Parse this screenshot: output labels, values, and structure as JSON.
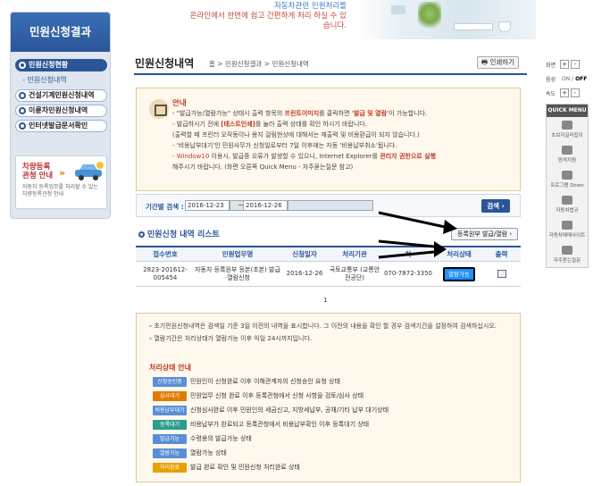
{
  "banner": {
    "line1": "자동차관련 민원처리를",
    "line2": "온라인에서 한번에 쉽고 간편하게 처리 하실 수 있습니다."
  },
  "sidebar": {
    "title": "민원신청결과",
    "items": [
      {
        "label": "민원신청현황",
        "active": true
      },
      {
        "label": "건설기계민원신청내역",
        "active": false
      },
      {
        "label": "이륜차민원신청내역",
        "active": false
      },
      {
        "label": "인터넷발급문서확인",
        "active": false
      }
    ],
    "sub_item": "민원신청내역",
    "car": {
      "title_line1": "차량등록",
      "title_line2": "관청 안내",
      "desc": "자동차 등록업무를 처리할 수 있는 차량등록관청 안내"
    }
  },
  "header": {
    "title": "민원신청내역",
    "breadcrumb": [
      "홈",
      "민원신청결과",
      "민원신청내역"
    ],
    "print_label": "인쇄하기"
  },
  "notice": {
    "title": "안내",
    "lines": [
      {
        "parts": [
          "- \"발급가능/열람가능\" 상태시 출력 항목의 ",
          "프린트이미지",
          "를 클릭하면 ",
          "'발급 및 열람'",
          "이 가능합니다."
        ]
      },
      {
        "parts": [
          "- 발급하시기 전에 ",
          "[테스트인쇄]",
          "를 눌러 출력 상태를 확인 하시기 바랍니다."
        ]
      },
      {
        "parts": [
          "  (출력할 때 프린터 오작동이나 용지 걸림현상에 대해서는 재출력 및 비용환급이 되지 않습니다.)"
        ]
      },
      {
        "parts": [
          "- '비용납부대기'인 민원사무가 신청일로부터 7일 이후에는 자동 '비용납부취소'됩니다."
        ]
      },
      {
        "parts": [
          "- ",
          "Window10",
          " 이용시, 발급중 오류가 발생할 수 있으니, Internet Explorer를 ",
          "관리자 권한으로 실행"
        ]
      },
      {
        "parts": [
          "  해주시기 바랍니다. (화면 오른쪽 Quick Menu - 자주묻는질문 참고)"
        ]
      }
    ]
  },
  "search": {
    "label": "기간별 검색 :",
    "from": "2016-12-23",
    "to": "2016-12-26",
    "button": "검색"
  },
  "list": {
    "title": "민원신청 내역 리스트",
    "reg_button": "등록원부 발급/열람",
    "columns": [
      "접수번호",
      "민원업무명",
      "신청일자",
      "처리기관",
      "처",
      "처리상태",
      "출력"
    ],
    "rows": [
      {
        "receipt_no": "2823-201612-005454",
        "task": "자동차 등록원부 등본(초본) 발급·열람신청",
        "date": "2016-12-26",
        "agency": "국토교통부 (교통안전공단)",
        "phone": "070-7872-3350",
        "status": "열람가능"
      }
    ],
    "page": "1"
  },
  "info": {
    "lines": [
      "초기민원신청내역은 검색일 기준 3일 이전의 내역을 표시합니다. 그 이전의 내용을 확인 할 경우 검색기간을 설정하여 검색하십시오.",
      "열람기간은 처리상태가 열람가능 이후 익일 24시까지입니다."
    ],
    "guide_title": "처리상태 안내",
    "guide": [
      {
        "badge": "신청승인중",
        "color": "#5a8fd6",
        "text": "민원인이 신청완료 이후 이해관계자의 신청승인 요청 상태"
      },
      {
        "badge": "심사대기",
        "color": "#e07b00",
        "text": "민원업무 신청 완료 이후 등록관청에서 신청 사항을 검토/심사 상태"
      },
      {
        "badge": "비용납부대기",
        "color": "#5a8fd6",
        "text": "신청심사완료 이후 민원인의 세금신고, 지방세납부, 공채/기타 납부 대기상태"
      },
      {
        "badge": "등록대기",
        "color": "#2a9d8f",
        "text": "비용납부가 완료되고 등록관청에서 비용납부확인 이후 등록대기 상태"
      },
      {
        "badge": "발급가능",
        "color": "#5a8fd6",
        "text": "수령용의 발급가능 상태"
      },
      {
        "badge": "열람가능",
        "color": "#5a8fd6",
        "text": "열람가능 상태"
      },
      {
        "badge": "처리완료",
        "color": "#e6a000",
        "text": "발급 완료 확인 및 민원신청 처리완료 상태"
      }
    ]
  },
  "quick": {
    "rows": [
      {
        "label": "화면",
        "btns": [
          "+",
          "-"
        ]
      },
      {
        "label": "음성",
        "toggle_on": "ON",
        "toggle_off": "OFF"
      },
      {
        "label": "속도",
        "btns": [
          "+",
          "-"
        ]
      }
    ],
    "menu_title": "QUICK MENU",
    "items": [
      "초보자길라잡이",
      "원격지원",
      "프로그램 Down",
      "자동차법규",
      "자동차매매사이트",
      "자주묻는질문"
    ]
  }
}
